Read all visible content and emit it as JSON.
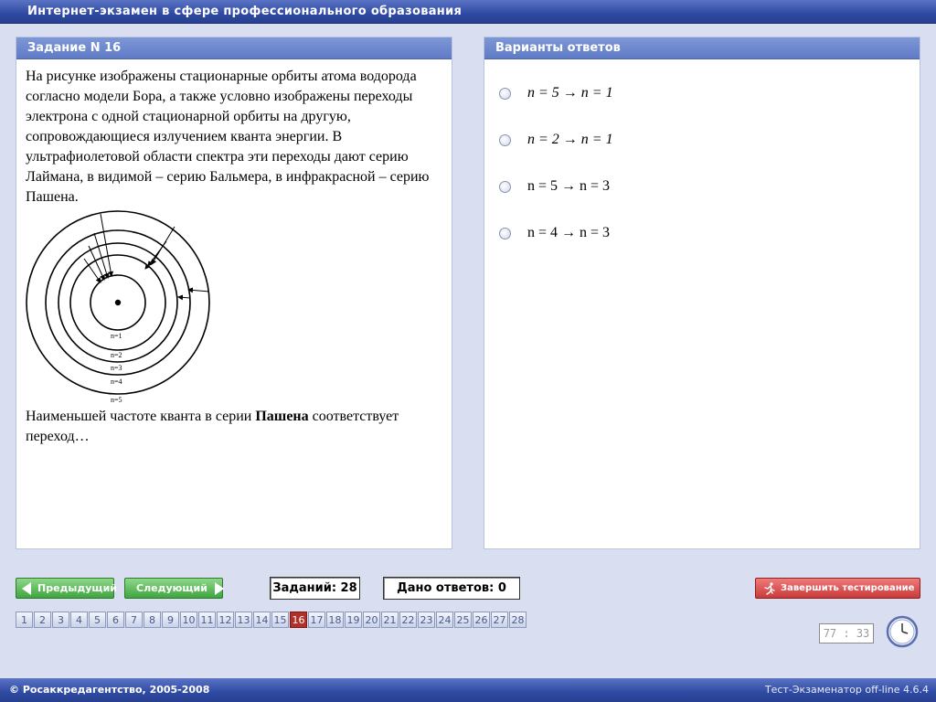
{
  "window": {
    "title": "Интернет-экзамен в сфере профессионального образования"
  },
  "task": {
    "header": "Задание N 16",
    "text": "На рисунке изображены стационарные орбиты атома водорода согласно модели Бора, а также условно изображены переходы электрона с одной стационарной орбиты на другую, сопровождающиеся излучением кванта энергии. В ультрафиолетовой области спектра эти переходы дают серию Лаймана, в видимой – серию Бальмера, в инфракрасной – серию Пашена.",
    "question_prefix": "Наименьшей частоте кванта в серии ",
    "question_bold": "Пашена",
    "question_suffix": " соответствует переход…",
    "figure": {
      "orbit_labels": [
        "n=1",
        "n=2",
        "n=3",
        "n=4",
        "n=5"
      ]
    }
  },
  "answers": {
    "header": "Варианты ответов",
    "options": [
      {
        "label": "n = 5 → n = 1",
        "italic": true
      },
      {
        "label": "n = 2 → n = 1",
        "italic": true
      },
      {
        "label": "n = 5 → n = 3",
        "italic": false
      },
      {
        "label": "n = 4 → n = 3",
        "italic": false
      }
    ]
  },
  "navigation": {
    "prev_label": "Предыдущий",
    "next_label": "Следующий",
    "tasks_count": "Заданий: 28",
    "answered_count": "Дано ответов: 0",
    "finish_label": "Завершить тестирование",
    "question_numbers": [
      "1",
      "2",
      "3",
      "4",
      "5",
      "6",
      "7",
      "8",
      "9",
      "10",
      "11",
      "12",
      "13",
      "14",
      "15",
      "16",
      "17",
      "18",
      "19",
      "20",
      "21",
      "22",
      "23",
      "24",
      "25",
      "26",
      "27",
      "28"
    ],
    "current_question": "16",
    "timer": "77 : 33"
  },
  "footer": {
    "copyright": "© Росаккредагентство, 2005-2008",
    "version": "Тест-Экзаменатор off-line 4.6.4"
  },
  "colors": {
    "title_bar": "#2f4aa3",
    "panel_header": "#6b86cc",
    "nav_green": "#3fa53f",
    "finish_red": "#c93a3a",
    "active_question": "#b3302a"
  }
}
